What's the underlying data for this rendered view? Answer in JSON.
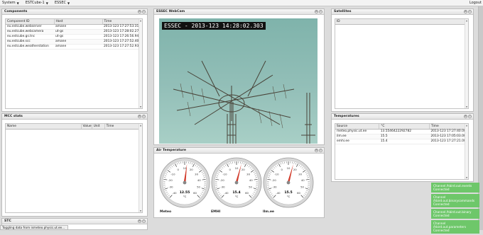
{
  "topbar": {
    "menus": [
      "System",
      "ESTCube-1",
      "ESSEC"
    ],
    "logout": "Logout"
  },
  "components": {
    "title": "Components",
    "columns": [
      "Component ID",
      "Host",
      "Time"
    ],
    "rows": [
      [
        "eu.estcube.webserver",
        "amane",
        "2013-123 17:27:53.319"
      ],
      [
        "eu.estcube.webcamera",
        "ut-gs",
        "2013-123 17:28:02.272"
      ],
      [
        "eu.estcube.gs.tnc",
        "ut-gs",
        "2013-123 17:26:56.944"
      ],
      [
        "eu.estcube.scc",
        "amane",
        "2013-123 17:27:52.401"
      ],
      [
        "eu.estcube.weatherstation",
        "amane",
        "2013-123 17:27:52.939"
      ]
    ]
  },
  "mcc": {
    "title": "MCC stats",
    "columns": [
      "Name",
      "Value",
      "Unit",
      "Time"
    ]
  },
  "stc": {
    "title": "STC"
  },
  "webcam": {
    "title": "ESSEC WebCam",
    "overlay": "ESSEC - 2013-123 14:28:02.303"
  },
  "air": {
    "title": "Air Temperature",
    "gauges": [
      {
        "value": 12.55,
        "value_label": "12.55",
        "unit": "°C",
        "caption": "Meteo"
      },
      {
        "value": 15.4,
        "value_label": "15.4",
        "unit": "°C",
        "caption": "EMHI"
      },
      {
        "value": 15.5,
        "value_label": "15.5",
        "unit": "°C",
        "caption": "Ilm.ee"
      }
    ],
    "ticks": [
      "-40",
      "-30",
      "-20",
      "-10",
      "0",
      "10",
      "20",
      "30",
      "40",
      "50",
      "60"
    ]
  },
  "satellites": {
    "title": "Satellites",
    "columns": [
      "ID"
    ]
  },
  "temperatures": {
    "title": "Temperatures",
    "columns": [
      "Source",
      "°C",
      "Time"
    ],
    "rows": [
      [
        "meteo.physic.ut.ee",
        "13.5546422292782",
        "2013-123 17:27:40.000"
      ],
      [
        "ilm.ee",
        "15.5",
        "2013-123 17:05:03.000"
      ],
      [
        "emhi.ee",
        "15.4",
        "2013-123 17:27:21.000"
      ]
    ]
  },
  "notifications": [
    "Channel /hbird.out.events Connected",
    "Channel /hbird.out.binarycommands Connected",
    "Channel /hbird.out.binary Connected",
    "Channel /hbird.out.parameters Connected"
  ],
  "status": "Toggling data from ismeteo.physic.ut.ee..."
}
